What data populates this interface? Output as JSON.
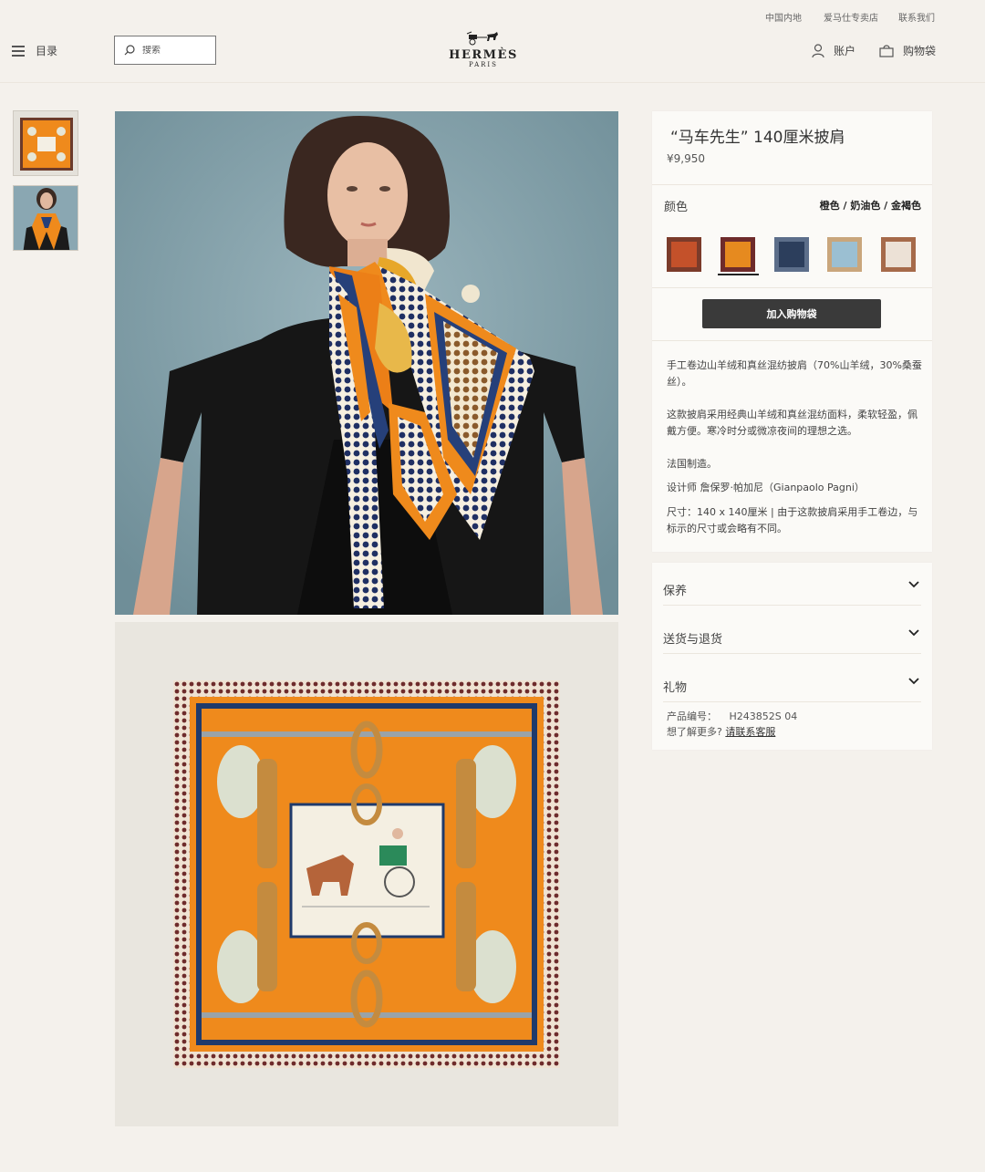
{
  "utility_nav": [
    "中国内地",
    "爱马仕专卖店",
    "联系我们"
  ],
  "header": {
    "menu_label": "目录",
    "search_placeholder": "搜索",
    "logo_brand": "HERMÈS",
    "logo_city": "PARIS",
    "account_label": "账户",
    "bag_label": "购物袋"
  },
  "product": {
    "title": "“马车先生” 140厘米披肩",
    "price": "¥9,950",
    "color_label": "颜色",
    "color_name": "橙色 / 奶油色 / 金褐色",
    "add_to_bag": "加入购物袋",
    "description": [
      "手工卷边山羊绒和真丝混纺披肩（70%山羊绒，30%桑蚕丝）。",
      "这款披肩采用经典山羊绒和真丝混纺面料，柔软轻盈，佩戴方便。寒冷时分或微凉夜间的理想之选。",
      "法国制造。",
      "设计师 詹保罗·帕加尼（Gianpaolo Pagni）",
      "尺寸：140 x 140厘米 | 由于这款披肩采用手工卷边，与标示的尺寸或会略有不同。"
    ]
  },
  "swatch_colors": [
    "#c4512a",
    "#e68a1f",
    "#2c3e5c",
    "#9bbfd2",
    "#d8b9a2"
  ],
  "accordion": [
    "保养",
    "送货与退货",
    "礼物"
  ],
  "product_code": {
    "label": "产品编号：",
    "value": "H243852S 04"
  },
  "help": {
    "question": "想了解更多?",
    "link": "请联系客服"
  },
  "colors": {
    "background": "#f4f1ec",
    "panel": "#fbfaf7",
    "button": "#3a3a3a",
    "scarf_orange": "#ef8a1c",
    "scarf_navy": "#1f3a6b"
  }
}
